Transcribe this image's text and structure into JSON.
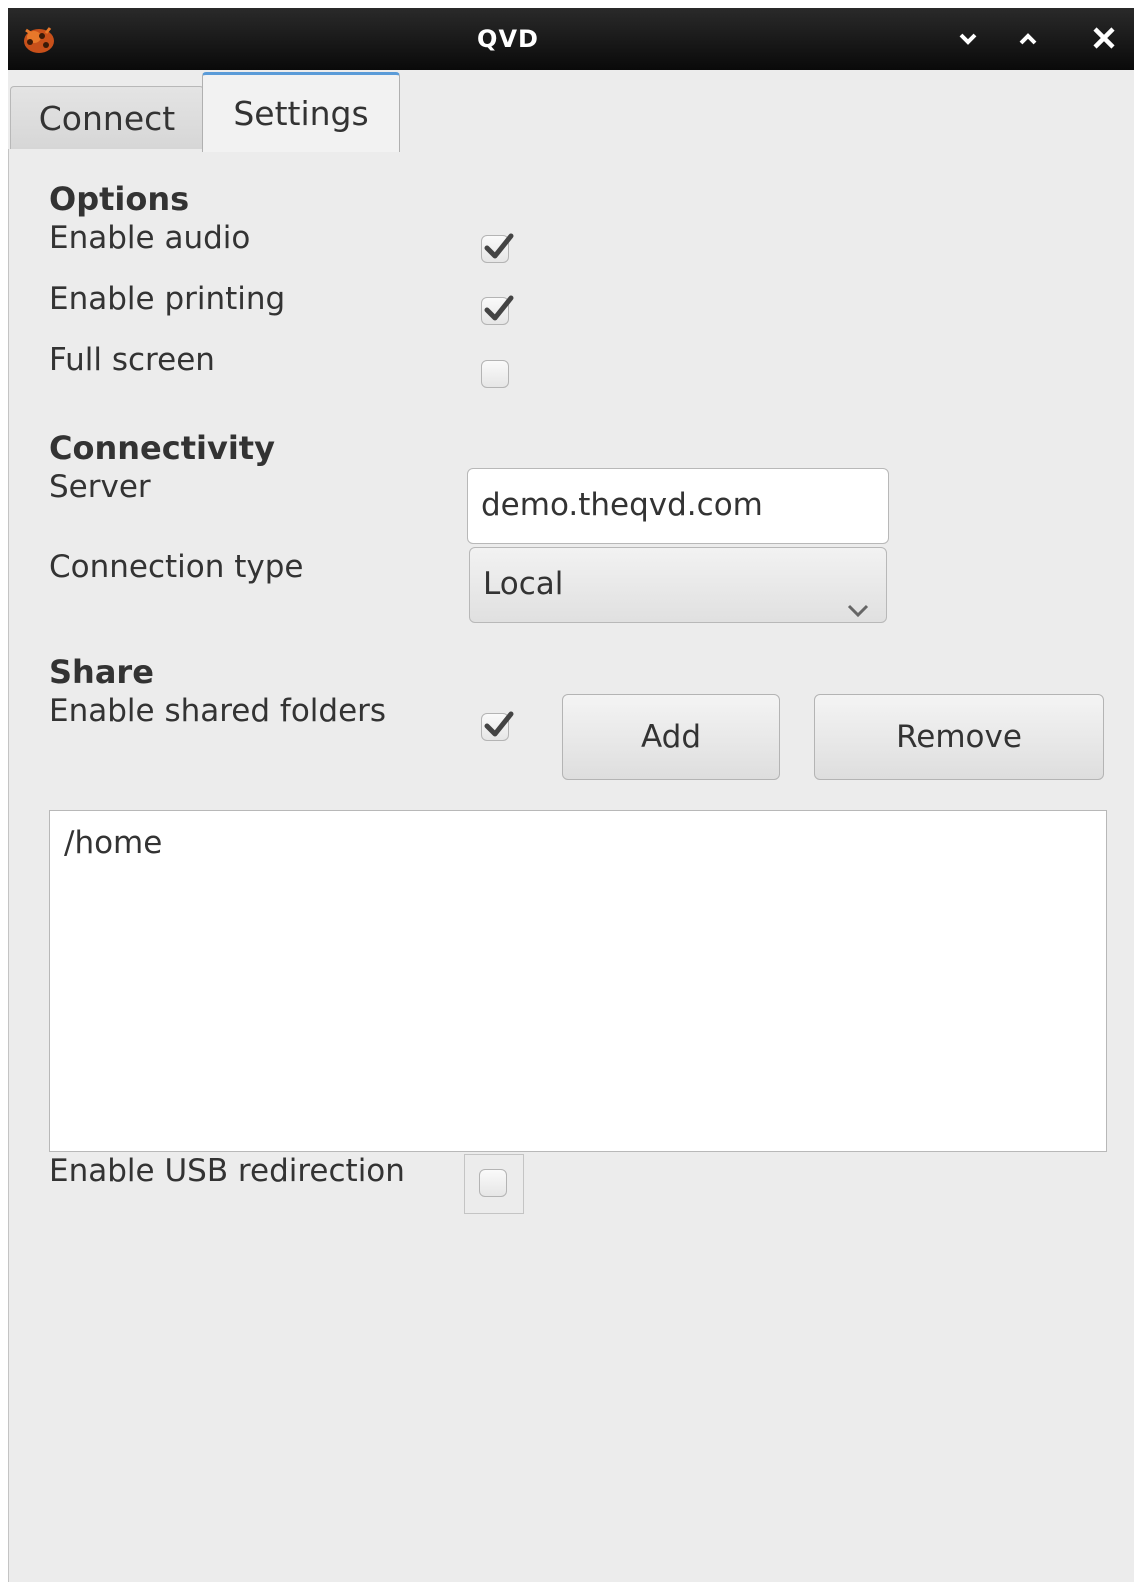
{
  "window": {
    "title": "QVD"
  },
  "titlebar_buttons": {
    "minimize_icon": "chevron-down-icon",
    "maximize_icon": "chevron-up-icon",
    "close_icon": "close-icon"
  },
  "tabs": [
    {
      "label": "Connect",
      "active": false
    },
    {
      "label": "Settings",
      "active": true
    }
  ],
  "options": {
    "heading": "Options",
    "enable_audio": {
      "label": "Enable audio",
      "checked": true
    },
    "enable_printing": {
      "label": "Enable printing",
      "checked": true
    },
    "full_screen": {
      "label": "Full screen",
      "checked": false
    }
  },
  "connectivity": {
    "heading": "Connectivity",
    "server_label": "Server",
    "server_value": "demo.theqvd.com",
    "connection_type_label": "Connection type",
    "connection_type_value": "Local"
  },
  "share": {
    "heading": "Share",
    "enable_shared_folders": {
      "label": "Enable shared folders",
      "checked": true
    },
    "add_label": "Add",
    "remove_label": "Remove",
    "folders": [
      "/home"
    ],
    "enable_usb_redirection": {
      "label": "Enable USB redirection",
      "checked": false
    }
  },
  "colors": {
    "titlebar": "#111111",
    "active_tab_accent": "#5a9bd8",
    "background": "#ececec"
  }
}
